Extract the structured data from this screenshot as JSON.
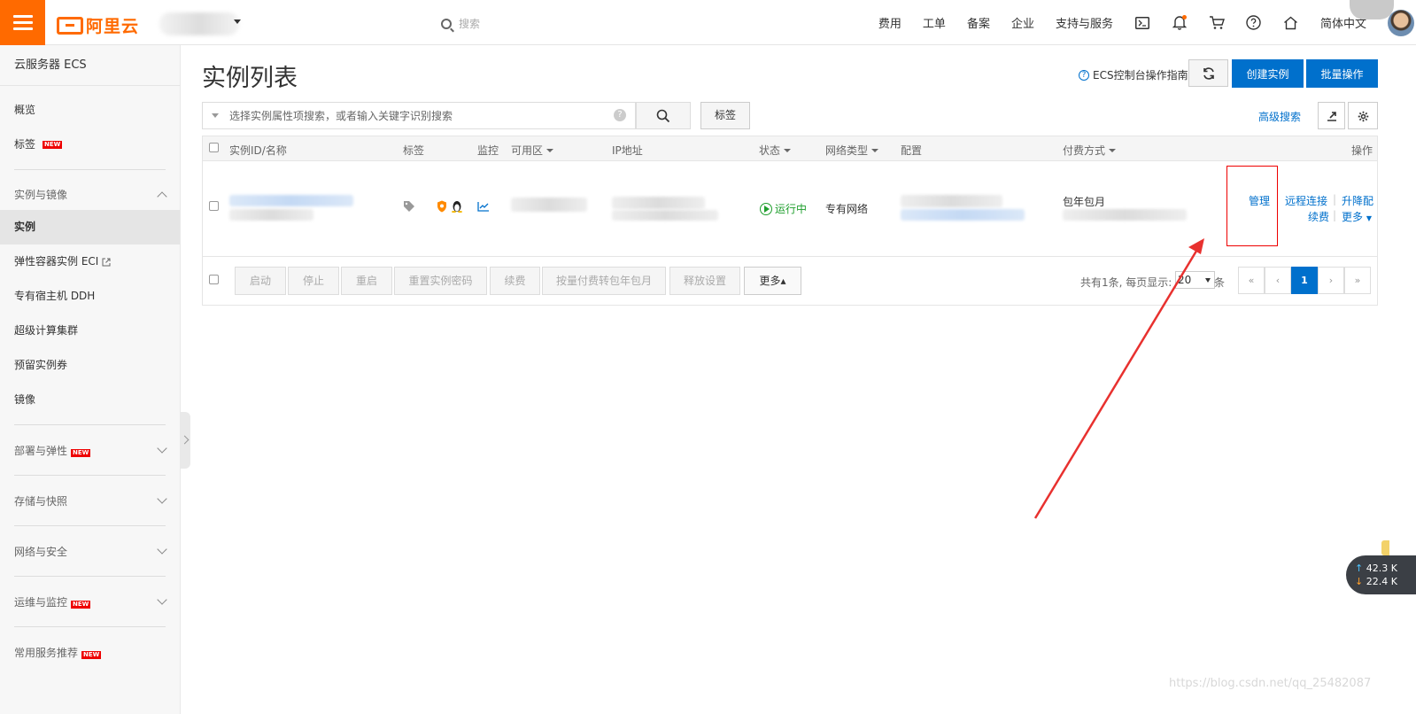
{
  "header": {
    "brand": "阿里云",
    "search_placeholder": "搜索",
    "nav": [
      "费用",
      "工单",
      "备案",
      "企业",
      "支持与服务"
    ],
    "language": "简体中文",
    "icons": [
      "terminal-icon",
      "bell-icon",
      "cart-icon",
      "help-icon",
      "home-icon"
    ]
  },
  "sidebar": {
    "title": "云服务器 ECS",
    "top_items": [
      "概览",
      "标签"
    ],
    "tag_badge": "NEW",
    "group_instance": "实例与镜像",
    "instance_items": [
      "实例",
      "弹性容器实例 ECI",
      "专有宿主机 DDH",
      "超级计算集群",
      "预留实例券",
      "镜像"
    ],
    "groups": [
      {
        "label": "部署与弹性",
        "badge": "NEW"
      },
      {
        "label": "存储与快照",
        "badge": ""
      },
      {
        "label": "网络与安全",
        "badge": ""
      },
      {
        "label": "运维与监控",
        "badge": "NEW"
      },
      {
        "label": "常用服务推荐",
        "badge": "NEW"
      }
    ]
  },
  "main": {
    "title": "实例列表",
    "guide_link": "ECS控制台操作指南",
    "create_button": "创建实例",
    "batch_button": "批量操作",
    "search_placeholder": "选择实例属性项搜索，或者输入关键字识别搜索",
    "tag_button": "标签",
    "advanced_search": "高级搜索",
    "columns": [
      "实例ID/名称",
      "标签",
      "监控",
      "可用区",
      "IP地址",
      "状态",
      "网络类型",
      "配置",
      "付费方式",
      "操作"
    ],
    "row": {
      "status": "运行中",
      "network": "专有网络",
      "billing": "包年包月",
      "actions": [
        "管理",
        "远程连接",
        "升降配",
        "续费",
        "更多"
      ]
    },
    "footer_buttons": [
      "启动",
      "停止",
      "重启",
      "重置实例密码",
      "续费",
      "按量付费转包年包月",
      "释放设置",
      "更多▴"
    ],
    "pager": {
      "summary": "共有1条, 每页显示:",
      "page_size": "20",
      "unit": "条",
      "current": "1",
      "controls": [
        "«",
        "‹",
        "1",
        "›",
        "»"
      ]
    }
  },
  "overlay": {
    "speed_up": "42.3 K",
    "speed_down": "22.4 K",
    "watermark": "https://blog.csdn.net/qq_25482087",
    "annotation_color": "#e8312f"
  },
  "colors": {
    "brand": "#ff6a00",
    "primary": "#0070cc",
    "running": "#1e9e2c"
  }
}
